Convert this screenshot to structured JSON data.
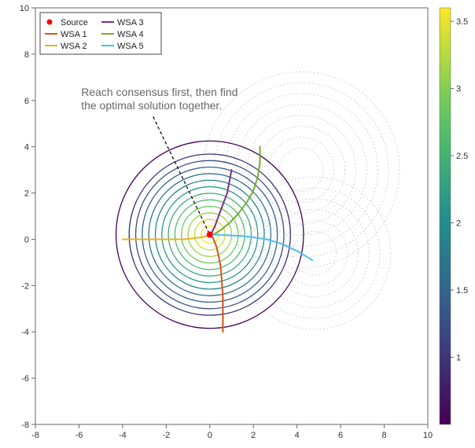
{
  "chart_data": {
    "type": "line",
    "title": "",
    "xlabel": "",
    "ylabel": "",
    "xlim": [
      -8,
      10
    ],
    "ylim": [
      -8,
      10
    ],
    "xticks": [
      -8,
      -6,
      -4,
      -2,
      0,
      2,
      4,
      6,
      8,
      10
    ],
    "yticks": [
      -8,
      -6,
      -4,
      -2,
      0,
      2,
      4,
      6,
      8,
      10
    ],
    "annotation": {
      "text_lines": [
        "Reach consensus first, then find",
        "the optimal solution together."
      ],
      "anchor_xy": [
        -5.9,
        6.2
      ],
      "dash_from": [
        -2.6,
        5.3
      ],
      "dash_to": [
        0,
        0.2
      ]
    },
    "source_point": {
      "x": 0,
      "y": 0.2,
      "color": "#ff0000"
    },
    "contours_main": {
      "center": [
        0,
        0.2
      ],
      "radii": [
        0.4,
        0.7,
        1.0,
        1.3,
        1.6,
        1.9,
        2.2,
        2.5,
        2.8,
        3.1,
        3.4,
        3.7,
        4.3
      ]
    },
    "contours_ghost": [
      {
        "center": [
          4.2,
          3.0
        ],
        "radii": [
          1.0,
          1.5,
          2.0,
          2.5,
          3.0,
          3.5,
          4.0,
          4.5
        ]
      },
      {
        "center": [
          4.8,
          -0.6
        ],
        "radii": [
          1.0,
          1.5,
          2.0,
          2.5,
          3.0,
          3.5
        ]
      }
    ],
    "colorbar": {
      "min": 0.5,
      "max": 3.6,
      "ticks": [
        1,
        1.5,
        2,
        2.5,
        3,
        3.5
      ]
    },
    "legend": [
      {
        "label": "Source",
        "type": "marker",
        "color": "#ff0000"
      },
      {
        "label": "WSA 1",
        "type": "line",
        "color": "#d95319"
      },
      {
        "label": "WSA 2",
        "type": "line",
        "color": "#edb120"
      },
      {
        "label": "WSA 3",
        "type": "line",
        "color": "#7e2f8e"
      },
      {
        "label": "WSA 4",
        "type": "line",
        "color": "#77ac30"
      },
      {
        "label": "WSA 5",
        "type": "line",
        "color": "#4dbeee"
      }
    ],
    "series": [
      {
        "name": "WSA 1",
        "color": "#d95319",
        "points": [
          [
            0.6,
            -4.0
          ],
          [
            0.6,
            -3.2
          ],
          [
            0.6,
            -2.5
          ],
          [
            0.55,
            -1.8
          ],
          [
            0.5,
            -1.2
          ],
          [
            0.4,
            -0.7
          ],
          [
            0.3,
            -0.3
          ],
          [
            0.15,
            0.05
          ],
          [
            0.05,
            0.15
          ]
        ]
      },
      {
        "name": "WSA 2",
        "color": "#edb120",
        "points": [
          [
            -4.0,
            0.0
          ],
          [
            -3.2,
            0.0
          ],
          [
            -2.5,
            0.0
          ],
          [
            -1.8,
            0.0
          ],
          [
            -1.2,
            0.0
          ],
          [
            -0.7,
            0.05
          ],
          [
            -0.3,
            0.1
          ],
          [
            0.0,
            0.18
          ]
        ]
      },
      {
        "name": "WSA 3",
        "color": "#7e2f8e",
        "points": [
          [
            1.0,
            3.0
          ],
          [
            0.9,
            2.5
          ],
          [
            0.8,
            2.0
          ],
          [
            0.6,
            1.5
          ],
          [
            0.4,
            1.0
          ],
          [
            0.25,
            0.6
          ],
          [
            0.1,
            0.3
          ],
          [
            0.03,
            0.2
          ]
        ]
      },
      {
        "name": "WSA 4",
        "color": "#77ac30",
        "points": [
          [
            2.3,
            4.0
          ],
          [
            2.3,
            3.3
          ],
          [
            2.2,
            2.7
          ],
          [
            2.0,
            2.1
          ],
          [
            1.7,
            1.6
          ],
          [
            1.3,
            1.1
          ],
          [
            0.9,
            0.7
          ],
          [
            0.5,
            0.4
          ],
          [
            0.2,
            0.22
          ],
          [
            0.05,
            0.2
          ]
        ]
      },
      {
        "name": "WSA 5",
        "color": "#4dbeee",
        "points": [
          [
            4.7,
            -0.9
          ],
          [
            4.0,
            -0.5
          ],
          [
            3.3,
            -0.2
          ],
          [
            2.6,
            0.0
          ],
          [
            1.9,
            0.1
          ],
          [
            1.3,
            0.15
          ],
          [
            0.7,
            0.18
          ],
          [
            0.3,
            0.2
          ],
          [
            0.05,
            0.2
          ]
        ]
      }
    ]
  }
}
